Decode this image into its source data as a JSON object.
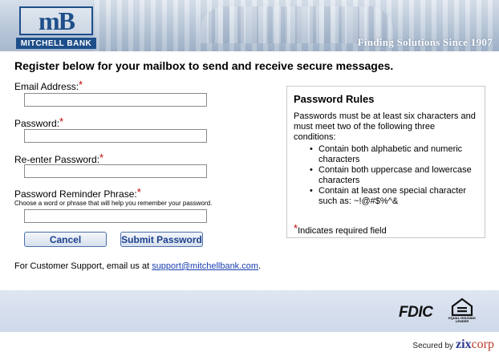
{
  "header": {
    "logo_mark": "mB",
    "bank_name": "MITCHELL BANK",
    "tagline": "Finding Solutions Since 1907"
  },
  "form": {
    "title": "Register below for your mailbox to send and receive secure messages.",
    "required_marker": "*",
    "email_label": "Email Address:",
    "email_value": "",
    "password_label": "Password:",
    "password_value": "",
    "reenter_label": "Re-enter Password:",
    "reenter_value": "",
    "reminder_label": "Password Reminder Phrase:",
    "reminder_hint": "Choose a word or phrase that will help you remember your password.",
    "reminder_value": "",
    "cancel_label": "Cancel",
    "submit_label": "Submit Password"
  },
  "support": {
    "text": "For Customer Support, email us at ",
    "email": "support@mitchellbank.com",
    "suffix": "."
  },
  "rules": {
    "title": "Password Rules",
    "intro": "Passwords must be at least six characters and must meet two of the following three conditions:",
    "items": [
      "Contain both alphabetic and numeric characters",
      "Contain both uppercase and lowercase characters",
      "Contain at least one special character such as: ~!@#$%^&"
    ],
    "required_note": "Indicates required field"
  },
  "footer": {
    "fdic": "FDIC",
    "ehl_text": "EQUAL HOUSING LENDER",
    "secured_by": "Secured by",
    "zix": "zix",
    "corp": "corp"
  },
  "colors": {
    "brand_blue": "#1e4f8a",
    "required_red": "#c00000",
    "link_blue": "#1a3fb0",
    "footer_bg": "#dfe6f2"
  }
}
